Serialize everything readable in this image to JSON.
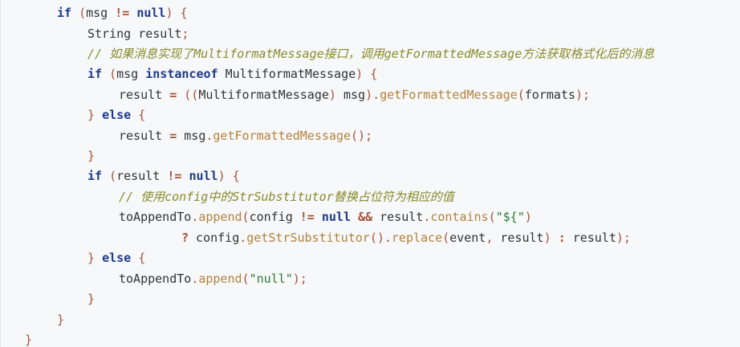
{
  "code": {
    "lines": [
      {
        "indent": 1,
        "tokens": [
          {
            "t": "kw",
            "v": "if"
          },
          {
            "t": "id",
            "v": " "
          },
          {
            "t": "punc",
            "v": "("
          },
          {
            "t": "id",
            "v": "msg "
          },
          {
            "t": "op",
            "v": "!="
          },
          {
            "t": "id",
            "v": " "
          },
          {
            "t": "kw",
            "v": "null"
          },
          {
            "t": "punc",
            "v": ")"
          },
          {
            "t": "id",
            "v": " "
          },
          {
            "t": "punc",
            "v": "{"
          }
        ]
      },
      {
        "indent": 2,
        "tokens": [
          {
            "t": "id",
            "v": "String result"
          },
          {
            "t": "punc",
            "v": ";"
          }
        ]
      },
      {
        "indent": 2,
        "tokens": [
          {
            "t": "cm",
            "v": "// 如果消息实现了MultiformatMessage接口，调用getFormattedMessage方法获取格式化后的消息"
          }
        ]
      },
      {
        "indent": 2,
        "tokens": [
          {
            "t": "kw",
            "v": "if"
          },
          {
            "t": "id",
            "v": " "
          },
          {
            "t": "punc",
            "v": "("
          },
          {
            "t": "id",
            "v": "msg "
          },
          {
            "t": "kw",
            "v": "instanceof"
          },
          {
            "t": "id",
            "v": " MultiformatMessage"
          },
          {
            "t": "punc",
            "v": ")"
          },
          {
            "t": "id",
            "v": " "
          },
          {
            "t": "punc",
            "v": "{"
          }
        ]
      },
      {
        "indent": 3,
        "tokens": [
          {
            "t": "id",
            "v": "result "
          },
          {
            "t": "op",
            "v": "="
          },
          {
            "t": "id",
            "v": " "
          },
          {
            "t": "punc",
            "v": "(("
          },
          {
            "t": "id",
            "v": "MultiformatMessage"
          },
          {
            "t": "punc",
            "v": ")"
          },
          {
            "t": "id",
            "v": " msg"
          },
          {
            "t": "punc",
            "v": ")"
          },
          {
            "t": "punc",
            "v": "."
          },
          {
            "t": "fn",
            "v": "getFormattedMessage"
          },
          {
            "t": "punc",
            "v": "("
          },
          {
            "t": "id",
            "v": "formats"
          },
          {
            "t": "punc",
            "v": ");"
          }
        ]
      },
      {
        "indent": 2,
        "tokens": [
          {
            "t": "punc",
            "v": "}"
          },
          {
            "t": "id",
            "v": " "
          },
          {
            "t": "kw",
            "v": "else"
          },
          {
            "t": "id",
            "v": " "
          },
          {
            "t": "punc",
            "v": "{"
          }
        ]
      },
      {
        "indent": 3,
        "tokens": [
          {
            "t": "id",
            "v": "result "
          },
          {
            "t": "op",
            "v": "="
          },
          {
            "t": "id",
            "v": " msg"
          },
          {
            "t": "punc",
            "v": "."
          },
          {
            "t": "fn",
            "v": "getFormattedMessage"
          },
          {
            "t": "punc",
            "v": "();"
          }
        ]
      },
      {
        "indent": 2,
        "tokens": [
          {
            "t": "punc",
            "v": "}"
          }
        ]
      },
      {
        "indent": 2,
        "tokens": [
          {
            "t": "kw",
            "v": "if"
          },
          {
            "t": "id",
            "v": " "
          },
          {
            "t": "punc",
            "v": "("
          },
          {
            "t": "id",
            "v": "result "
          },
          {
            "t": "op",
            "v": "!="
          },
          {
            "t": "id",
            "v": " "
          },
          {
            "t": "kw",
            "v": "null"
          },
          {
            "t": "punc",
            "v": ")"
          },
          {
            "t": "id",
            "v": " "
          },
          {
            "t": "punc",
            "v": "{"
          }
        ]
      },
      {
        "indent": 3,
        "tokens": [
          {
            "t": "cm",
            "v": "// 使用config中的StrSubstitutor替换占位符为相应的值"
          }
        ]
      },
      {
        "indent": 3,
        "tokens": [
          {
            "t": "id",
            "v": "toAppendTo"
          },
          {
            "t": "punc",
            "v": "."
          },
          {
            "t": "fn",
            "v": "append"
          },
          {
            "t": "punc",
            "v": "("
          },
          {
            "t": "id",
            "v": "config "
          },
          {
            "t": "op",
            "v": "!="
          },
          {
            "t": "id",
            "v": " "
          },
          {
            "t": "kw",
            "v": "null"
          },
          {
            "t": "id",
            "v": " "
          },
          {
            "t": "op",
            "v": "&&"
          },
          {
            "t": "id",
            "v": " result"
          },
          {
            "t": "punc",
            "v": "."
          },
          {
            "t": "fn",
            "v": "contains"
          },
          {
            "t": "punc",
            "v": "("
          },
          {
            "t": "str",
            "v": "\"${\""
          },
          {
            "t": "punc",
            "v": ")"
          }
        ]
      },
      {
        "indent": 4,
        "tokens": [
          {
            "t": "op",
            "v": "?"
          },
          {
            "t": "id",
            "v": " config"
          },
          {
            "t": "punc",
            "v": "."
          },
          {
            "t": "fn",
            "v": "getStrSubstitutor"
          },
          {
            "t": "punc",
            "v": "()."
          },
          {
            "t": "fn",
            "v": "replace"
          },
          {
            "t": "punc",
            "v": "("
          },
          {
            "t": "id",
            "v": "event"
          },
          {
            "t": "punc",
            "v": ","
          },
          {
            "t": "id",
            "v": " result"
          },
          {
            "t": "punc",
            "v": ")"
          },
          {
            "t": "id",
            "v": " "
          },
          {
            "t": "op",
            "v": ":"
          },
          {
            "t": "id",
            "v": " result"
          },
          {
            "t": "punc",
            "v": ");"
          }
        ]
      },
      {
        "indent": 2,
        "tokens": [
          {
            "t": "punc",
            "v": "}"
          },
          {
            "t": "id",
            "v": " "
          },
          {
            "t": "kw",
            "v": "else"
          },
          {
            "t": "id",
            "v": " "
          },
          {
            "t": "punc",
            "v": "{"
          }
        ]
      },
      {
        "indent": 3,
        "tokens": [
          {
            "t": "id",
            "v": "toAppendTo"
          },
          {
            "t": "punc",
            "v": "."
          },
          {
            "t": "fn",
            "v": "append"
          },
          {
            "t": "punc",
            "v": "("
          },
          {
            "t": "str",
            "v": "\"null\""
          },
          {
            "t": "punc",
            "v": ");"
          }
        ]
      },
      {
        "indent": 2,
        "tokens": [
          {
            "t": "punc",
            "v": "}"
          }
        ]
      },
      {
        "indent": 1,
        "tokens": [
          {
            "t": "punc",
            "v": "}"
          }
        ]
      },
      {
        "indent": 0,
        "tokens": [
          {
            "t": "punc",
            "v": "}"
          }
        ]
      }
    ]
  }
}
